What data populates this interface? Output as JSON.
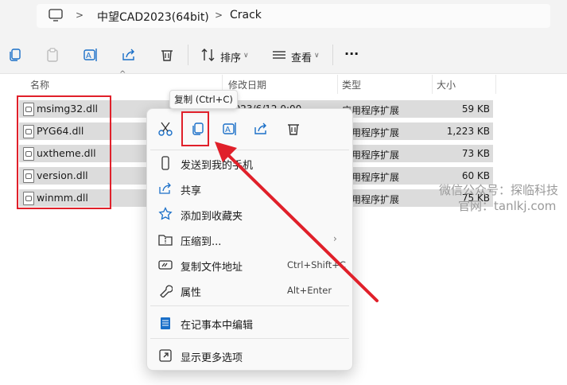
{
  "address": {
    "crumbs": [
      "中望CAD2023(64bit)",
      "Crack"
    ]
  },
  "toolbar": {
    "sort_label": "排序",
    "view_label": "查看",
    "more_label": "···"
  },
  "columns": {
    "name": "名称",
    "date": "修改日期",
    "type": "类型",
    "size": "大小"
  },
  "files": [
    {
      "name": "msimg32.dll",
      "date": "2023/6/12 0:00",
      "type": "应用程序扩展",
      "size": "59 KB"
    },
    {
      "name": "PYG64.dll",
      "date": "",
      "type": "应用程序扩展",
      "size": "1,223 KB"
    },
    {
      "name": "uxtheme.dll",
      "date": "",
      "type": "应用程序扩展",
      "size": "73 KB"
    },
    {
      "name": "version.dll",
      "date": "",
      "type": "应用程序扩展",
      "size": "60 KB"
    },
    {
      "name": "winmm.dll",
      "date": "",
      "type": "应用程序扩展",
      "size": "75 KB"
    }
  ],
  "tooltip": "复制 (Ctrl+C)",
  "menu": {
    "items": [
      {
        "label": "发送到我的手机",
        "shortcut": ""
      },
      {
        "label": "共享",
        "shortcut": ""
      },
      {
        "label": "添加到收藏夹",
        "shortcut": ""
      },
      {
        "label": "压缩到...",
        "shortcut": ""
      },
      {
        "label": "复制文件地址",
        "shortcut": "Ctrl+Shift+C"
      },
      {
        "label": "属性",
        "shortcut": "Alt+Enter"
      },
      {
        "label": "在记事本中编辑",
        "shortcut": ""
      },
      {
        "label": "显示更多选项",
        "shortcut": ""
      }
    ]
  },
  "watermark": {
    "line1": "微信公众号：探临科技",
    "line2": "官网：tanlkj.com"
  },
  "colors": {
    "highlight_red": "#e0202a",
    "row_selected": "#dcdcdc",
    "accent_blue": "#1a6fc8"
  }
}
